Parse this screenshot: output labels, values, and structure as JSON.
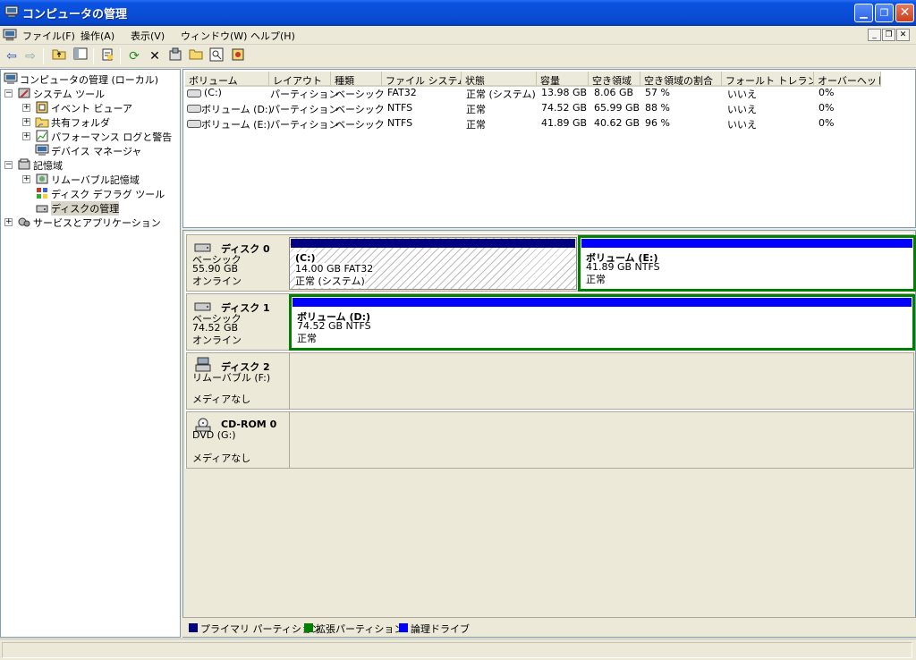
{
  "window": {
    "title": "コンピュータの管理"
  },
  "menu": [
    "ファイル(F)",
    "操作(A)",
    "表示(V)",
    "ウィンドウ(W)",
    "ヘルプ(H)"
  ],
  "tree": [
    {
      "label": "コンピュータの管理 (ローカル)",
      "level": 0,
      "expander": ""
    },
    {
      "label": "システム ツール",
      "level": 1,
      "expander": "−"
    },
    {
      "label": "イベント ビューア",
      "level": 2,
      "expander": "+"
    },
    {
      "label": "共有フォルダ",
      "level": 2,
      "expander": "+"
    },
    {
      "label": "パフォーマンス ログと警告",
      "level": 2,
      "expander": "+"
    },
    {
      "label": "デバイス マネージャ",
      "level": 2,
      "expander": ""
    },
    {
      "label": "記憶域",
      "level": 1,
      "expander": "−"
    },
    {
      "label": "リムーバブル記憶域",
      "level": 2,
      "expander": "+"
    },
    {
      "label": "ディスク デフラグ ツール",
      "level": 2,
      "expander": ""
    },
    {
      "label": "ディスクの管理",
      "level": 2,
      "expander": "",
      "selected": true
    },
    {
      "label": "サービスとアプリケーション",
      "level": 1,
      "expander": "+"
    }
  ],
  "volumes": {
    "columns": [
      "ボリューム",
      "レイアウト",
      "種類",
      "ファイル システム",
      "状態",
      "容量",
      "空き領域",
      "空き領域の割合",
      "フォールト トレランス",
      "オーバーヘッド"
    ],
    "rows": [
      [
        "(C:)",
        "パーティション",
        "ベーシック",
        "FAT32",
        "正常 (システム)",
        "13.98 GB",
        "8.06 GB",
        "57 %",
        "いいえ",
        "0%"
      ],
      [
        "ボリューム (D:)",
        "パーティション",
        "ベーシック",
        "NTFS",
        "正常",
        "74.52 GB",
        "65.99 GB",
        "88 %",
        "いいえ",
        "0%"
      ],
      [
        "ボリューム (E:)",
        "パーティション",
        "ベーシック",
        "NTFS",
        "正常",
        "41.89 GB",
        "40.62 GB",
        "96 %",
        "いいえ",
        "0%"
      ]
    ]
  },
  "disks": [
    {
      "name": "ディスク 0",
      "lines": [
        "ベーシック",
        "55.90 GB",
        "オンライン"
      ],
      "partitions": [
        {
          "name": "(C:)",
          "detail": "14.00 GB FAT32",
          "status": "正常 (システム)"
        },
        {
          "name": "ボリューム (E:)",
          "detail": "41.89 GB NTFS",
          "status": "正常"
        }
      ]
    },
    {
      "name": "ディスク 1",
      "lines": [
        "ベーシック",
        "74.52 GB",
        "オンライン"
      ],
      "partitions": [
        {
          "name": "ボリューム (D:)",
          "detail": "74.52 GB NTFS",
          "status": "正常"
        }
      ]
    },
    {
      "name": "ディスク 2",
      "lines": [
        "リムーバブル (F:)",
        "",
        "メディアなし"
      ],
      "partitions": []
    },
    {
      "name": "CD-ROM 0",
      "lines": [
        "DVD (G:)",
        "",
        "メディアなし"
      ],
      "partitions": []
    }
  ],
  "legend": [
    {
      "label": "プライマリ パーティション",
      "color": "#000080"
    },
    {
      "label": "拡張パーティション",
      "color": "#008000"
    },
    {
      "label": "論理ドライブ",
      "color": "#0000ff"
    }
  ],
  "colors": {
    "primary_bar": "#000080",
    "logical_bar": "#0000ff",
    "extended_border": "#008000",
    "selection": "#d8d4c8"
  },
  "toolbar_icons": [
    "back-icon",
    "forward-icon",
    "up-folder-icon",
    "show-hide-tree-icon",
    "properties-icon",
    "refresh-icon",
    "delete-icon",
    "settings-icon",
    "open-icon",
    "search-icon",
    "help-icon"
  ]
}
